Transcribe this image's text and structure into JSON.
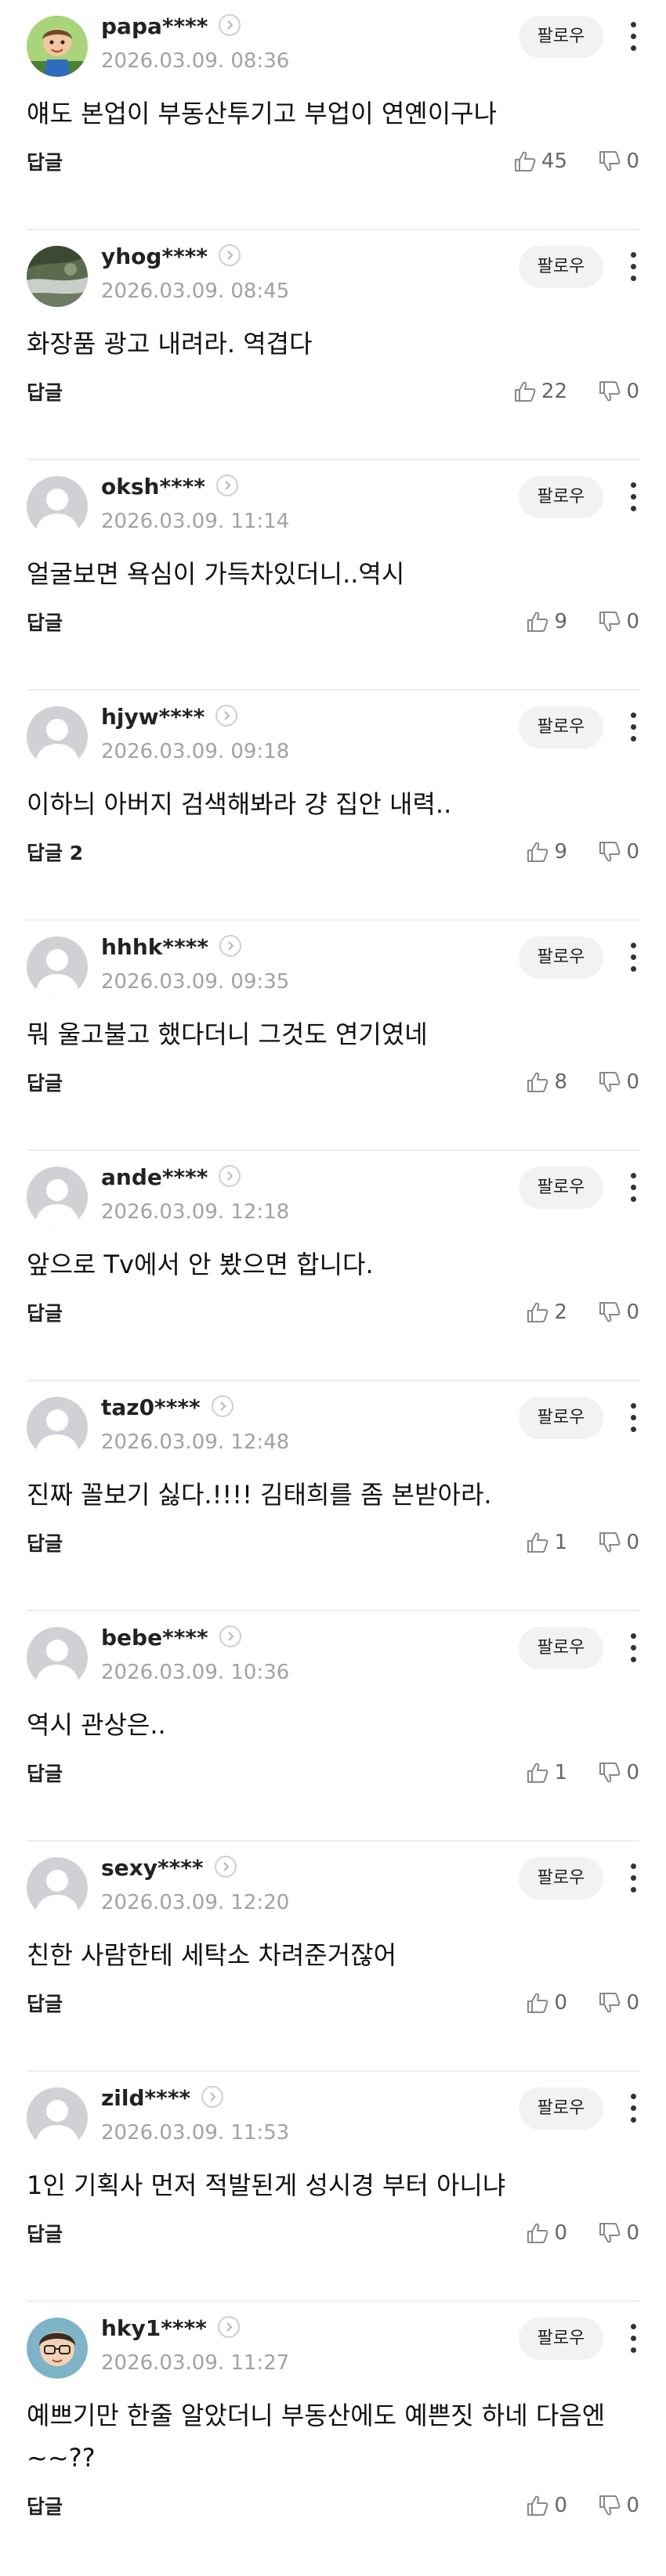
{
  "labels": {
    "follow": "팔로우",
    "reply": "답글"
  },
  "comments": [
    {
      "user": "papa****",
      "time": "2026.03.09. 08:36",
      "text": "얘도 본업이 부동산투기고 부업이 연옌이구나",
      "reply_label": "답글",
      "likes": "45",
      "dislikes": "0",
      "avatar": "cartoon-avatar"
    },
    {
      "user": "yhog****",
      "time": "2026.03.09. 08:45",
      "text": "화장품 광고 내려라. 역겹다",
      "reply_label": "답글",
      "likes": "22",
      "dislikes": "0",
      "avatar": "landscape-photo-avatar"
    },
    {
      "user": "oksh****",
      "time": "2026.03.09. 11:14",
      "text": "얼굴보면 욕심이 가득차있더니..역시",
      "reply_label": "답글",
      "likes": "9",
      "dislikes": "0",
      "avatar": "default-avatar"
    },
    {
      "user": "hjyw****",
      "time": "2026.03.09. 09:18",
      "text": "이하늬 아버지 검색해봐라 걍 집안 내력..",
      "reply_label": "답글 2",
      "likes": "9",
      "dislikes": "0",
      "avatar": "default-avatar"
    },
    {
      "user": "hhhk****",
      "time": "2026.03.09. 09:35",
      "text": "뭐 울고불고 했다더니 그것도 연기였네",
      "reply_label": "답글",
      "likes": "8",
      "dislikes": "0",
      "avatar": "default-avatar"
    },
    {
      "user": "ande****",
      "time": "2026.03.09. 12:18",
      "text": "앞으로 Tv에서 안 봤으면 합니다.",
      "reply_label": "답글",
      "likes": "2",
      "dislikes": "0",
      "avatar": "default-avatar"
    },
    {
      "user": "taz0****",
      "time": "2026.03.09. 12:48",
      "text": "진짜 꼴보기 싫다.!!!! 김태희를 좀 본받아라.",
      "reply_label": "답글",
      "likes": "1",
      "dislikes": "0",
      "avatar": "default-avatar"
    },
    {
      "user": "bebe****",
      "time": "2026.03.09. 10:36",
      "text": "역시 관상은..",
      "reply_label": "답글",
      "likes": "1",
      "dislikes": "0",
      "avatar": "default-avatar"
    },
    {
      "user": "sexy****",
      "time": "2026.03.09. 12:20",
      "text": "친한 사람한테 세탁소 차려준거잖어",
      "reply_label": "답글",
      "likes": "0",
      "dislikes": "0",
      "avatar": "default-avatar"
    },
    {
      "user": "zild****",
      "time": "2026.03.09. 11:53",
      "text": "1인 기획사 먼저 적발된게 성시경 부터 아니냐",
      "reply_label": "답글",
      "likes": "0",
      "dislikes": "0",
      "avatar": "default-avatar"
    },
    {
      "user": "hky1****",
      "time": "2026.03.09. 11:27",
      "text": "예쁘기만 한줄 알았더니 부동산에도 예쁜짓 하네 다음엔~~??",
      "reply_label": "답글",
      "likes": "0",
      "dislikes": "0",
      "avatar": "cartoon-glasses-avatar"
    }
  ],
  "colors": {
    "timestamp": "#a2a2a2",
    "follow_bg": "#f2f2f2",
    "divider": "#eeeeee",
    "default_avatar_bg": "#cfd1d4"
  }
}
